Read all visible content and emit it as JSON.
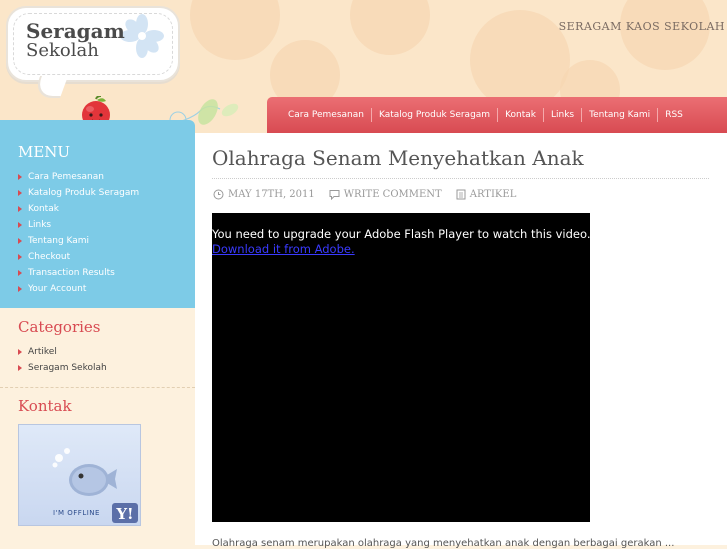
{
  "header": {
    "logo_line1": "Seragam",
    "logo_line2": "Sekolah",
    "tagline": "SERAGAM KAOS SEKOLAH"
  },
  "nav": {
    "items": [
      {
        "label": "Cara Pemesanan"
      },
      {
        "label": "Katalog Produk Seragam"
      },
      {
        "label": "Kontak"
      },
      {
        "label": "Links"
      },
      {
        "label": "Tentang Kami"
      },
      {
        "label": "RSS"
      }
    ]
  },
  "sidebar": {
    "menu_title": "MENU",
    "menu_items": [
      {
        "label": "Cara Pemesanan"
      },
      {
        "label": "Katalog Produk Seragam"
      },
      {
        "label": "Kontak"
      },
      {
        "label": "Links"
      },
      {
        "label": "Tentang Kami"
      },
      {
        "label": "Checkout"
      },
      {
        "label": "Transaction Results"
      },
      {
        "label": "Your Account"
      }
    ],
    "categories_title": "Categories",
    "categories": [
      {
        "label": "Artikel"
      },
      {
        "label": "Seragam Sekolah"
      }
    ],
    "kontak_title": "Kontak",
    "ym_status": "I'M OFFLINE"
  },
  "post": {
    "title": "Olahraga Senam Menyehatkan Anak",
    "date": "MAY 17TH, 2011",
    "comment": "WRITE COMMENT",
    "category": "ARTIKEL",
    "flash_message": "You need to upgrade your Adobe Flash Player to watch this video.",
    "flash_link": "Download it from Adobe.",
    "body_excerpt": "Olahraga senam merupakan olahraga yang menyehatkan anak dengan berbagai gerakan ..."
  },
  "colors": {
    "nav_red": "#d84b52",
    "menu_blue": "#7dcbe7",
    "heading_red": "#d84b52"
  }
}
